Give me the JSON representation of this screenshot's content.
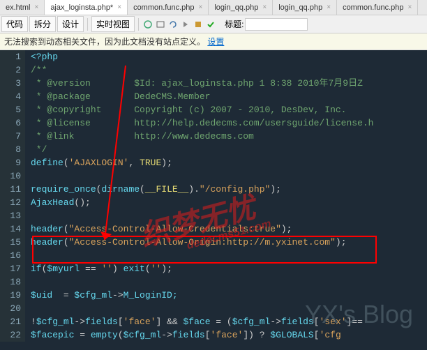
{
  "tabs": [
    {
      "label": "ex.html"
    },
    {
      "label": "ajax_loginsta.php*",
      "active": true
    },
    {
      "label": "common.func.php"
    },
    {
      "label": "login_qq.php"
    },
    {
      "label": "login_qq.php"
    },
    {
      "label": "common.func.php"
    }
  ],
  "toolbar": {
    "code": "代码",
    "split": "拆分",
    "design": "设计",
    "live": "实时视图",
    "title_label": "标题:"
  },
  "infobar": {
    "msg": "无法搜索到动态相关文件，因为此文档没有站点定义。",
    "link": "设置"
  },
  "code_lines": [
    {
      "n": 1,
      "segs": [
        {
          "t": "<?php",
          "c": "key"
        }
      ]
    },
    {
      "n": 2,
      "segs": [
        {
          "t": "/**",
          "c": "com"
        }
      ]
    },
    {
      "n": 3,
      "segs": [
        {
          "t": " * @version        $Id: ajax_loginsta.php 1 8:38 2010年7月9日Z ",
          "c": "com"
        }
      ]
    },
    {
      "n": 4,
      "segs": [
        {
          "t": " * @package        DedeCMS.Member",
          "c": "com"
        }
      ]
    },
    {
      "n": 5,
      "segs": [
        {
          "t": " * @copyright      Copyright (c) 2007 - 2010, DesDev, Inc.",
          "c": "com"
        }
      ]
    },
    {
      "n": 6,
      "segs": [
        {
          "t": " * @license        http://help.dedecms.com/usersguide/license.h",
          "c": "com"
        }
      ]
    },
    {
      "n": 7,
      "segs": [
        {
          "t": " * @link           http://www.dedecms.com",
          "c": "com"
        }
      ]
    },
    {
      "n": 8,
      "segs": [
        {
          "t": " */",
          "c": "com"
        }
      ]
    },
    {
      "n": 9,
      "segs": [
        {
          "t": "define",
          "c": "key"
        },
        {
          "t": "(",
          "c": "punc"
        },
        {
          "t": "'AJAXLOGIN'",
          "c": "str"
        },
        {
          "t": ", ",
          "c": "punc"
        },
        {
          "t": "TRUE",
          "c": "const"
        },
        {
          "t": ");",
          "c": "punc"
        }
      ]
    },
    {
      "n": 10,
      "segs": []
    },
    {
      "n": 11,
      "segs": [
        {
          "t": "require_once",
          "c": "key"
        },
        {
          "t": "(",
          "c": "punc"
        },
        {
          "t": "dirname",
          "c": "key"
        },
        {
          "t": "(",
          "c": "punc"
        },
        {
          "t": "__FILE__",
          "c": "const"
        },
        {
          "t": ").",
          "c": "punc"
        },
        {
          "t": "\"/config.php\"",
          "c": "str"
        },
        {
          "t": ");",
          "c": "punc"
        }
      ]
    },
    {
      "n": 12,
      "segs": [
        {
          "t": "AjaxHead",
          "c": "key"
        },
        {
          "t": "();",
          "c": "punc"
        }
      ]
    },
    {
      "n": 13,
      "segs": []
    },
    {
      "n": 14,
      "segs": [
        {
          "t": "header",
          "c": "key"
        },
        {
          "t": "(",
          "c": "punc"
        },
        {
          "t": "\"Access-Control-Allow-Credentials:true\"",
          "c": "str"
        },
        {
          "t": ");",
          "c": "punc"
        }
      ]
    },
    {
      "n": 15,
      "segs": [
        {
          "t": "header",
          "c": "key"
        },
        {
          "t": "(",
          "c": "punc"
        },
        {
          "t": "\"Access-Control-Allow-Origin:http://m.yxinet.com\"",
          "c": "str"
        },
        {
          "t": ");",
          "c": "punc"
        }
      ]
    },
    {
      "n": 16,
      "segs": []
    },
    {
      "n": 17,
      "segs": [
        {
          "t": "if",
          "c": "key"
        },
        {
          "t": "(",
          "c": "punc"
        },
        {
          "t": "$myurl ",
          "c": "key"
        },
        {
          "t": "== ",
          "c": "punc"
        },
        {
          "t": "''",
          "c": "str"
        },
        {
          "t": ") ",
          "c": "punc"
        },
        {
          "t": "exit",
          "c": "key"
        },
        {
          "t": "(",
          "c": "punc"
        },
        {
          "t": "''",
          "c": "str"
        },
        {
          "t": ");",
          "c": "punc"
        }
      ]
    },
    {
      "n": 18,
      "segs": []
    },
    {
      "n": 19,
      "segs": [
        {
          "t": "$uid  ",
          "c": "key"
        },
        {
          "t": "= ",
          "c": "punc"
        },
        {
          "t": "$cfg_ml",
          "c": "key"
        },
        {
          "t": "->",
          "c": "punc"
        },
        {
          "t": "M_LoginID;",
          "c": "key"
        }
      ]
    },
    {
      "n": 20,
      "segs": []
    },
    {
      "n": 21,
      "segs": [
        {
          "t": "!",
          "c": "punc"
        },
        {
          "t": "$cfg_ml",
          "c": "key"
        },
        {
          "t": "->",
          "c": "punc"
        },
        {
          "t": "fields",
          "c": "key"
        },
        {
          "t": "[",
          "c": "punc"
        },
        {
          "t": "'face'",
          "c": "str"
        },
        {
          "t": "] && ",
          "c": "punc"
        },
        {
          "t": "$face ",
          "c": "key"
        },
        {
          "t": "= (",
          "c": "punc"
        },
        {
          "t": "$cfg_ml",
          "c": "key"
        },
        {
          "t": "->",
          "c": "punc"
        },
        {
          "t": "fields",
          "c": "key"
        },
        {
          "t": "[",
          "c": "punc"
        },
        {
          "t": "'sex'",
          "c": "str"
        },
        {
          "t": "]==",
          "c": "punc"
        }
      ]
    },
    {
      "n": 22,
      "segs": [
        {
          "t": "$facepic ",
          "c": "key"
        },
        {
          "t": "= ",
          "c": "punc"
        },
        {
          "t": "empty",
          "c": "key"
        },
        {
          "t": "(",
          "c": "punc"
        },
        {
          "t": "$cfg_ml",
          "c": "key"
        },
        {
          "t": "->",
          "c": "punc"
        },
        {
          "t": "fields",
          "c": "key"
        },
        {
          "t": "[",
          "c": "punc"
        },
        {
          "t": "'face'",
          "c": "str"
        },
        {
          "t": "]) ? ",
          "c": "punc"
        },
        {
          "t": "$GLOBALS",
          "c": "key"
        },
        {
          "t": "[",
          "c": "punc"
        },
        {
          "t": "'cfg",
          "c": "str"
        }
      ]
    }
  ],
  "watermarks": {
    "main": "织梦无忧",
    "sub": "dedecms51.com",
    "blog": "YX's Blog"
  }
}
